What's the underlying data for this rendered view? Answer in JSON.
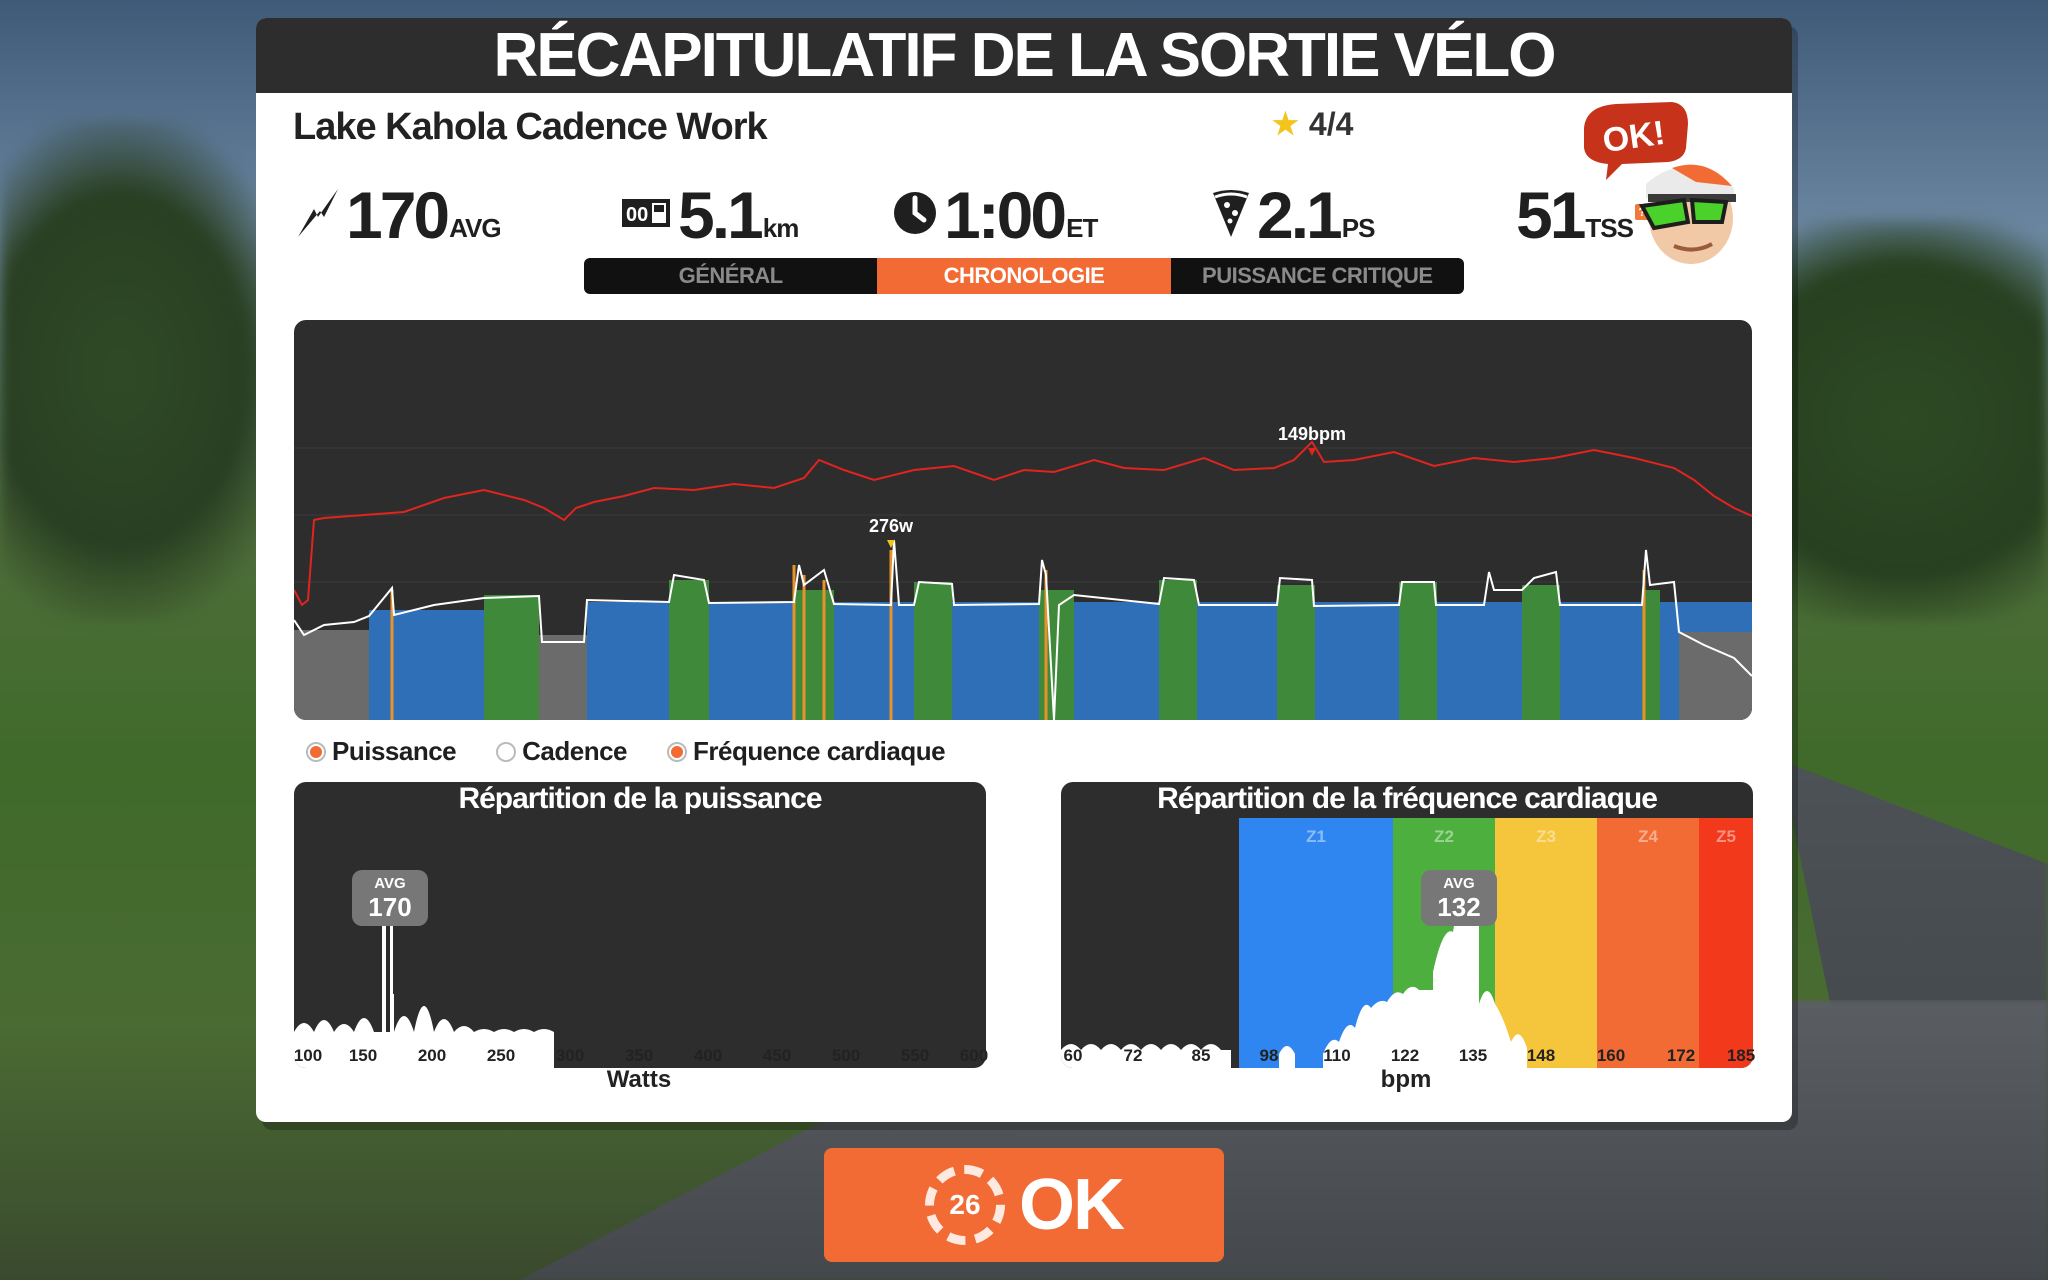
{
  "header": {
    "title": "RÉCAPITULATIF DE LA SORTIE VÉLO"
  },
  "workout": {
    "name": "Lake Kahola Cadence Work",
    "rating": "4/4"
  },
  "stats": {
    "power": {
      "value": "170",
      "unit": "AVG",
      "icon": "lightning-icon"
    },
    "distance": {
      "value": "5.1",
      "unit": "km",
      "icon": "odometer-icon"
    },
    "time": {
      "value": "1:00",
      "unit": "ET",
      "icon": "clock-icon"
    },
    "pizza": {
      "value": "2.1",
      "unit": "PS",
      "icon": "pizza-icon"
    },
    "tss": {
      "value": "51",
      "unit": "TSS",
      "help": "?"
    }
  },
  "mascot": {
    "bubble": "OK!"
  },
  "tabs": [
    {
      "label": "GÉNÉRAL",
      "active": false
    },
    {
      "label": "CHRONOLOGIE",
      "active": true
    },
    {
      "label": "PUISSANCE CRITIQUE",
      "active": false
    }
  ],
  "timeline": {
    "max_power_label": "276w",
    "max_hr_label": "149bpm",
    "colors": {
      "hr_line": "#e0241e",
      "power_line": "#ffffff",
      "zone_blue": "#2f6fb8",
      "zone_green": "#3f8a3a",
      "zone_grey": "#6b6b6b",
      "zone_orange": "#e8922a"
    }
  },
  "legend": [
    {
      "label": "Puissance",
      "on": true
    },
    {
      "label": "Cadence",
      "on": false
    },
    {
      "label": "Fréquence cardiaque",
      "on": true
    }
  ],
  "power_dist": {
    "title": "Répartition de la puissance",
    "avg_label": "AVG",
    "avg_value": "170",
    "axis_title": "Watts",
    "ticks": [
      "100",
      "150",
      "200",
      "250",
      "300",
      "350",
      "400",
      "450",
      "500",
      "550",
      "600"
    ]
  },
  "hr_dist": {
    "title": "Répartition de la fréquence cardiaque",
    "avg_label": "AVG",
    "avg_value": "132",
    "axis_title": "bpm",
    "ticks": [
      "60",
      "72",
      "85",
      "98",
      "110",
      "122",
      "135",
      "148",
      "160",
      "172",
      "185"
    ],
    "zones": [
      {
        "label": "Z1",
        "color": "#2f86f0"
      },
      {
        "label": "Z2",
        "color": "#4caf3e"
      },
      {
        "label": "Z3",
        "color": "#f5c53c"
      },
      {
        "label": "Z4",
        "color": "#f26b34"
      },
      {
        "label": "Z5",
        "color": "#f2391c"
      }
    ]
  },
  "ok_button": {
    "countdown": "26",
    "label": "OK"
  }
}
